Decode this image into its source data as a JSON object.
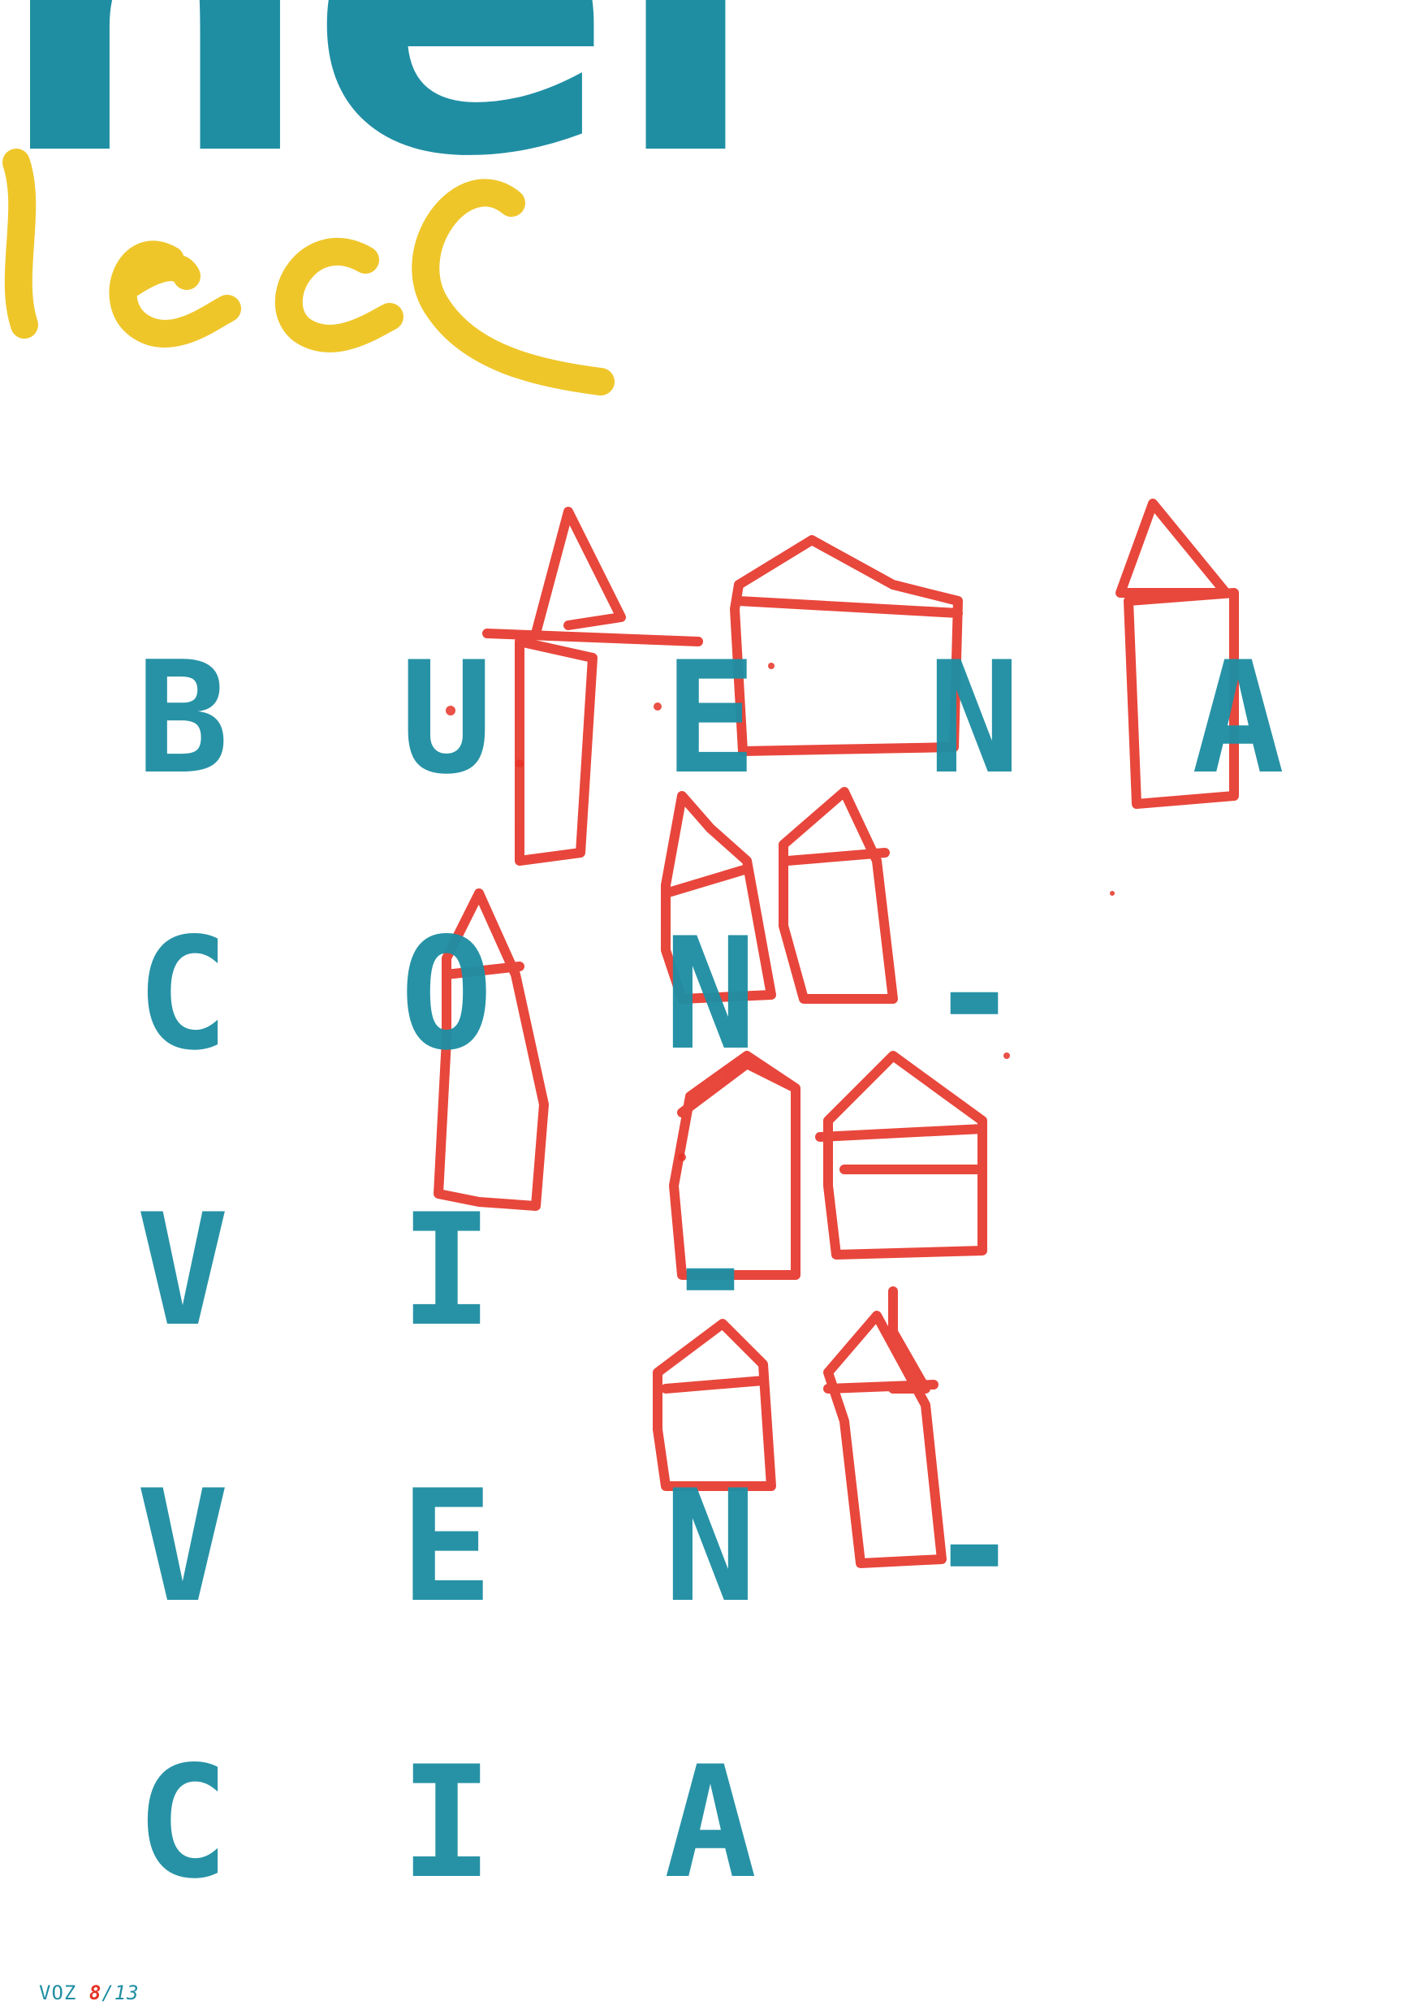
{
  "poster": {
    "top_title": "nei",
    "scrawl_word": "rece",
    "grid_rows": [
      [
        "B",
        "U",
        "E",
        "N",
        "A"
      ],
      [
        "C",
        "O",
        "N",
        "-",
        ""
      ],
      [
        "V",
        "I",
        "-",
        "",
        ""
      ],
      [
        "V",
        "E",
        "N",
        "-",
        ""
      ],
      [
        "C",
        "I",
        "A",
        "",
        ""
      ]
    ]
  },
  "footer": {
    "label": "VOZ",
    "current": "8",
    "separator": "/",
    "total": "13"
  },
  "colors": {
    "teal": "#1f8ea3",
    "red": "#e63327",
    "yellow": "#eec21a",
    "background": "#ffffff"
  }
}
